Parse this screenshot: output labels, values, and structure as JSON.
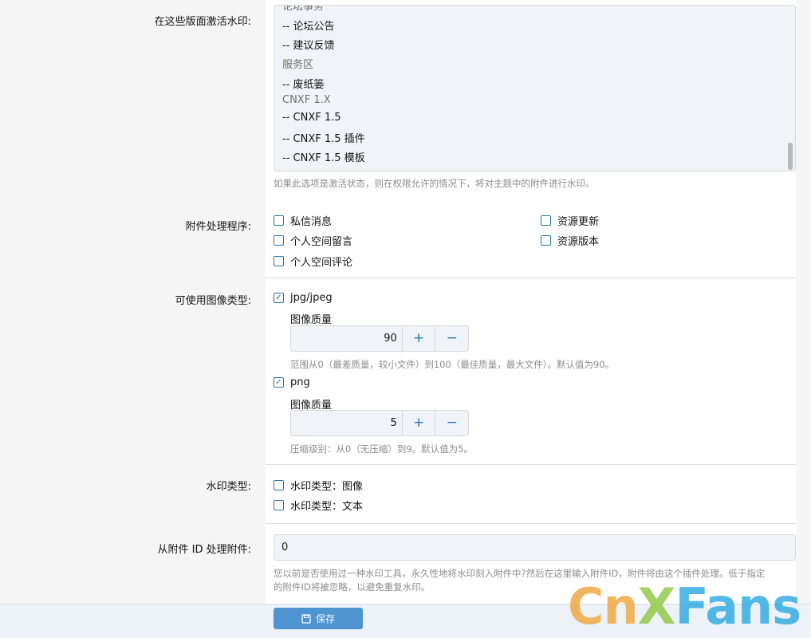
{
  "labels": {
    "activate_forums": "在这些版面激活水印:",
    "attachment_handlers": "附件处理程序:",
    "image_types": "可使用图像类型:",
    "watermark_type": "水印类型:",
    "process_from_id": "从附件 ID 处理附件:"
  },
  "forum_list": {
    "partial_top": "论坛事务",
    "options": [
      {
        "text": "-- 论坛公告",
        "group": false
      },
      {
        "text": "-- 建议反馈",
        "group": false
      },
      {
        "text": "服务区",
        "group": true
      },
      {
        "text": "-- 废纸篓",
        "group": false
      },
      {
        "text": "CNXF 1.X",
        "group": true
      },
      {
        "text": "-- CNXF 1.5",
        "group": false
      },
      {
        "text": "-- CNXF 1.5 插件",
        "group": false
      },
      {
        "text": "-- CNXF 1.5 模板",
        "group": false
      }
    ],
    "hint": "如果此选项是激活状态，则在权限允许的情况下，将对主题中的附件进行水印。"
  },
  "handlers": [
    {
      "label": "私信消息",
      "checked": false
    },
    {
      "label": "个人空间留言",
      "checked": false
    },
    {
      "label": "个人空间评论",
      "checked": false
    },
    {
      "label": "资源更新",
      "checked": false
    },
    {
      "label": "资源版本",
      "checked": false
    }
  ],
  "image_types": {
    "jpg": {
      "label": "jpg/jpeg",
      "checked": true,
      "quality_label": "图像质量",
      "value": "90",
      "hint": "范围从0（最差质量，较小文件）到100（最佳质量，最大文件）。默认值为90。"
    },
    "png": {
      "label": "png",
      "checked": true,
      "quality_label": "图像质量",
      "value": "5",
      "hint": "压缩级别：从0（无压缩）到9。默认值为5。"
    },
    "plus": "+",
    "minus": "−"
  },
  "watermark_types": [
    {
      "label": "水印类型：图像",
      "checked": false
    },
    {
      "label": "水印类型：文本",
      "checked": false
    }
  ],
  "process_from_id": {
    "value": "0",
    "hint_line1": "您以前是否使用过一种水印工具，永久性地将水印刻入附件中?然后在这里输入附件ID，附件将由这个插件处理。低于指定",
    "hint_line2": "的附件ID将被忽略，以避免重复水印。"
  },
  "footer": {
    "save_label": "保存",
    "save_icon": "save-icon"
  },
  "logo": {
    "text_c": "C",
    "text_n": "n",
    "text_x": "X",
    "text_f": "F",
    "text_ans": "ans",
    "colors": {
      "orange": "#f0a53a",
      "green": "#8cc63f",
      "blue": "#29a8e0"
    }
  },
  "checkmark": "✓"
}
